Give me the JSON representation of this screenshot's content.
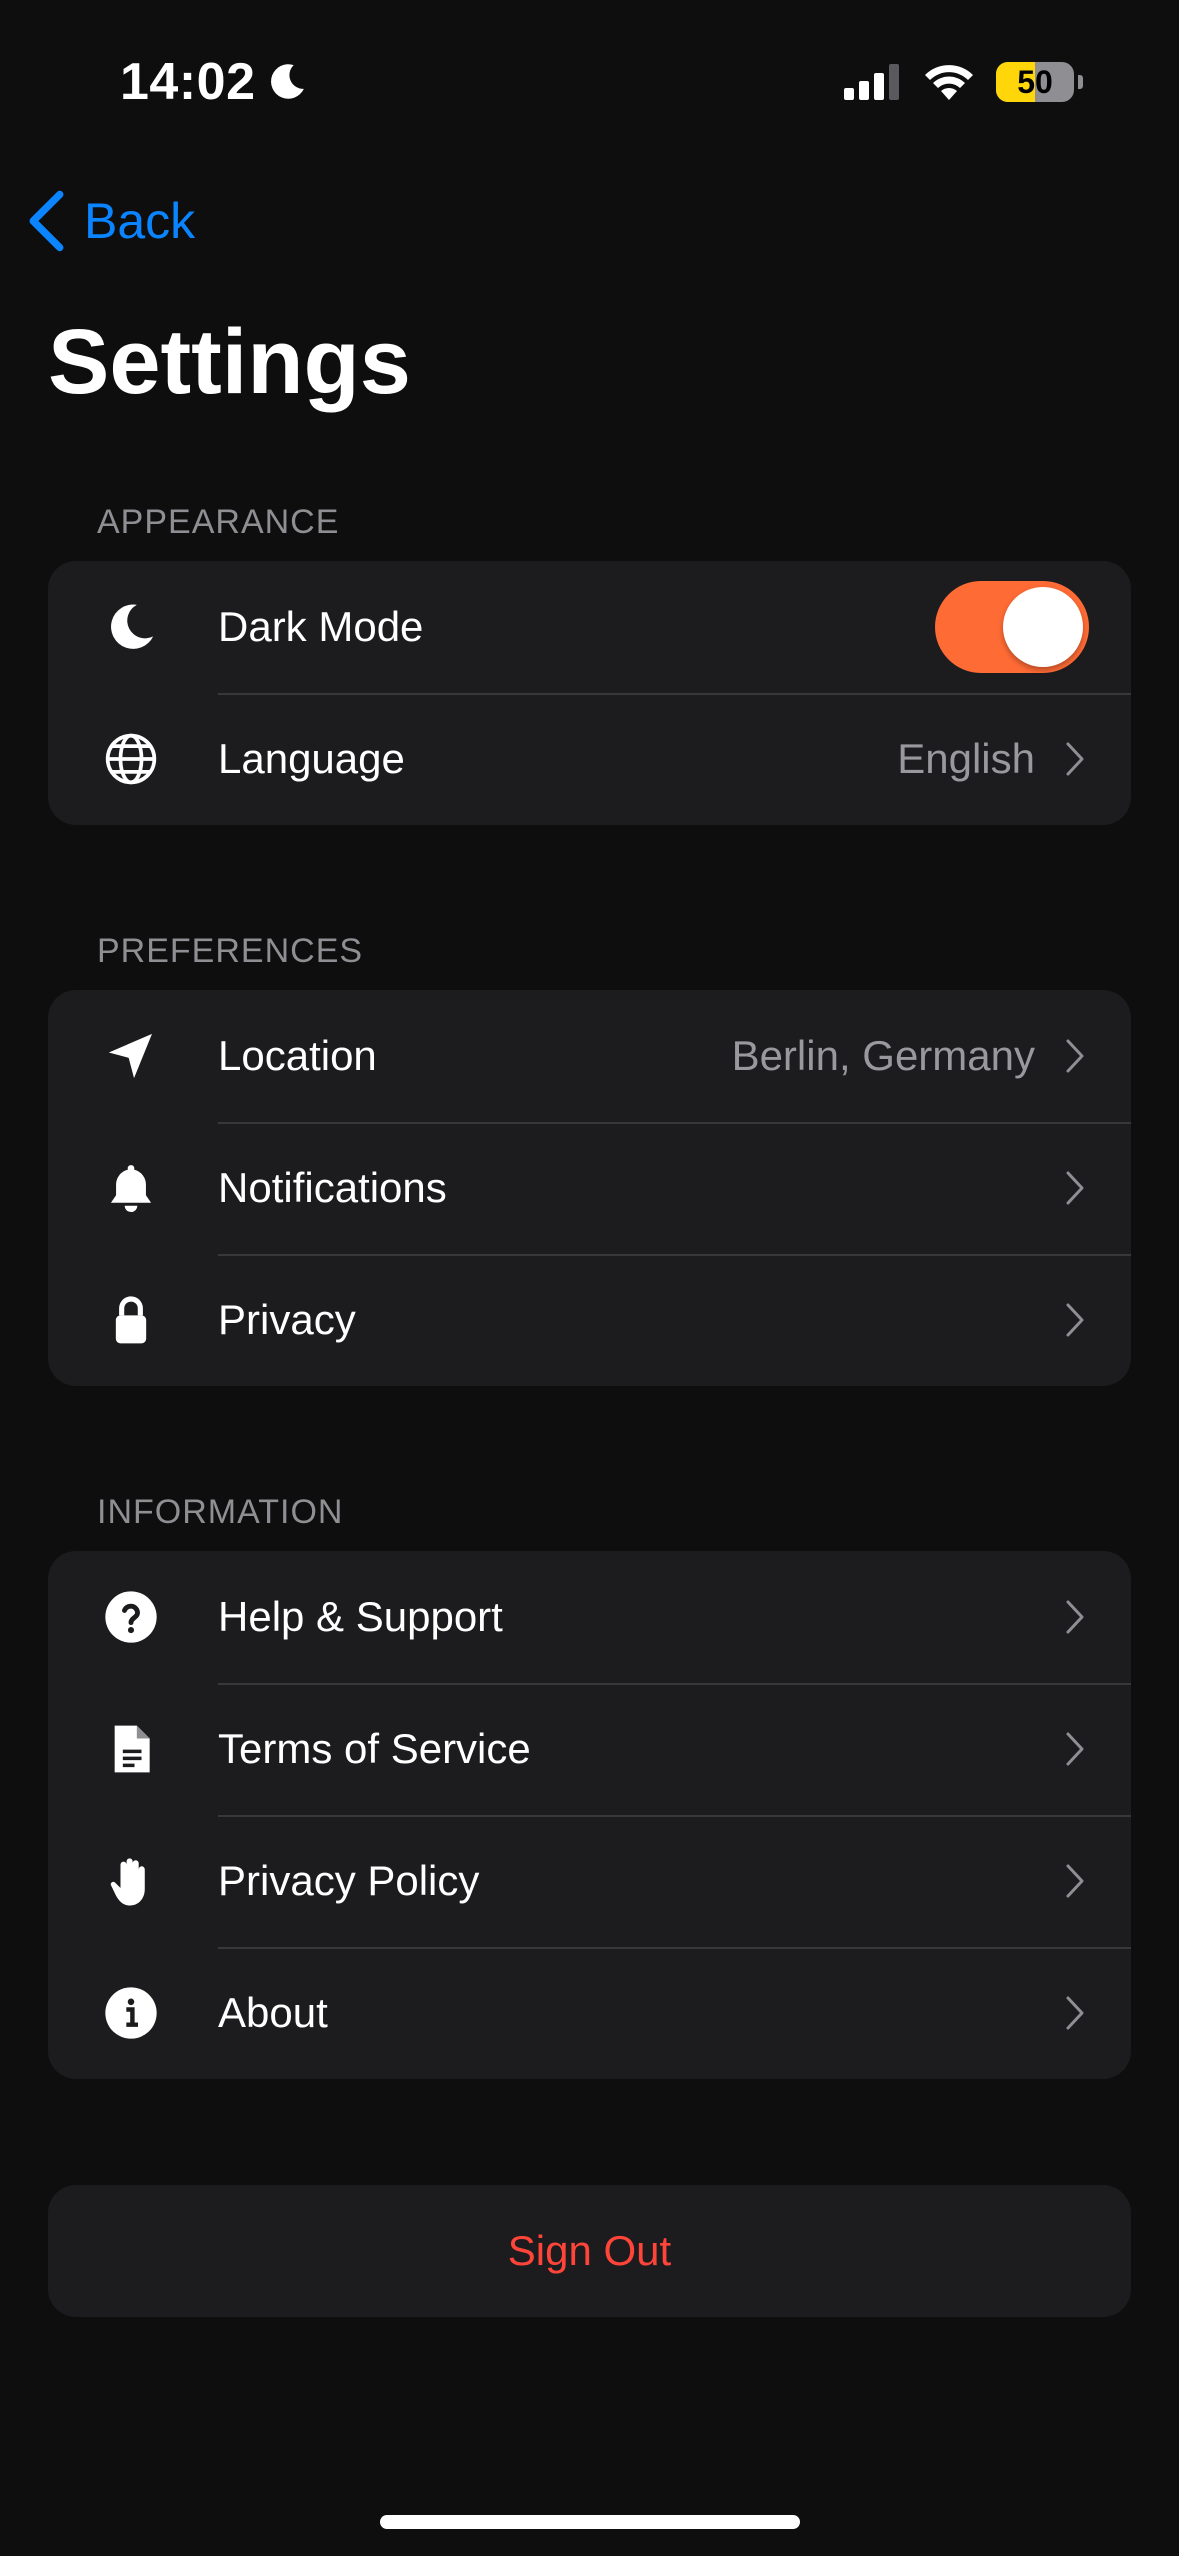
{
  "status_bar": {
    "time": "14:02",
    "battery": 50,
    "battery_label": "50"
  },
  "nav": {
    "back_label": "Back",
    "title": "Settings"
  },
  "sections": {
    "appearance": {
      "header": "APPEARANCE",
      "items": [
        {
          "label": "Dark Mode",
          "icon": "moon-icon",
          "toggle": true
        },
        {
          "label": "Language",
          "icon": "globe-icon",
          "value": "English"
        }
      ]
    },
    "preferences": {
      "header": "PREFERENCES",
      "items": [
        {
          "label": "Location",
          "icon": "location-arrow-icon",
          "value": "Berlin, Germany"
        },
        {
          "label": "Notifications",
          "icon": "bell-icon"
        },
        {
          "label": "Privacy",
          "icon": "lock-icon"
        }
      ]
    },
    "information": {
      "header": "INFORMATION",
      "items": [
        {
          "label": "Help & Support",
          "icon": "question-circle-icon"
        },
        {
          "label": "Terms of Service",
          "icon": "document-icon"
        },
        {
          "label": "Privacy Policy",
          "icon": "hand-icon"
        },
        {
          "label": "About",
          "icon": "info-circle-icon"
        }
      ]
    }
  },
  "sign_out_label": "Sign Out",
  "colors": {
    "accent": "#0a84ff",
    "toggle_on": "#ff6b35",
    "destructive": "#ff453a",
    "battery": "#ffd60a"
  }
}
